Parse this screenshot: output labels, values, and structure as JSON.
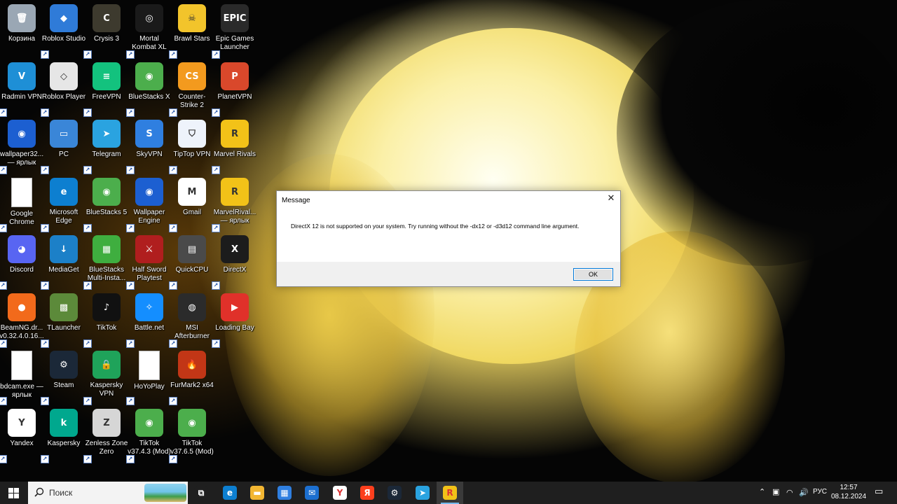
{
  "desktop": {
    "icons": [
      {
        "label": "Корзина",
        "icon": "recycle-bin-icon",
        "color": "#9aa7b4",
        "glyph": "🗑"
      },
      {
        "label": "Roblox Studio",
        "icon": "roblox-studio-icon",
        "color": "#2f7bd8",
        "glyph": "◆"
      },
      {
        "label": "Crysis 3",
        "icon": "crysis-icon",
        "color": "#3d3a2e",
        "glyph": "C"
      },
      {
        "label": "Mortal Kombat XL",
        "icon": "mortal-kombat-icon",
        "color": "#1a1a1a",
        "glyph": "◎"
      },
      {
        "label": "Brawl Stars",
        "icon": "brawl-stars-icon",
        "color": "#f2c42b",
        "glyph": "☠"
      },
      {
        "label": "Epic Games Launcher",
        "icon": "epic-games-icon",
        "color": "#2a2a2a",
        "glyph": "EPIC"
      },
      {
        "label": "Radmin VPN",
        "icon": "radmin-vpn-icon",
        "color": "#1e8fd6",
        "glyph": "V"
      },
      {
        "label": "Roblox Player",
        "icon": "roblox-player-icon",
        "color": "#e6e6e6",
        "glyph": "◇"
      },
      {
        "label": "FreeVPN",
        "icon": "freevpn-icon",
        "color": "#13c27e",
        "glyph": "≡"
      },
      {
        "label": "BlueStacks X",
        "icon": "bluestacks-x-icon",
        "color": "#4cae4c",
        "glyph": "◉"
      },
      {
        "label": "Counter-Strike 2",
        "icon": "counter-strike-icon",
        "color": "#f39a1e",
        "glyph": "CS"
      },
      {
        "label": "PlanetVPN",
        "icon": "planetvpn-icon",
        "color": "#d9482b",
        "glyph": "P"
      },
      {
        "label": "wallpaper32... — ярлык",
        "icon": "wallpaper-engine-icon",
        "color": "#1c5fd1",
        "glyph": "◉"
      },
      {
        "label": "PC",
        "icon": "computer-icon",
        "color": "#3a86d8",
        "glyph": "▭"
      },
      {
        "label": "Telegram",
        "icon": "telegram-icon",
        "color": "#2aa3e0",
        "glyph": "➤"
      },
      {
        "label": "SkyVPN",
        "icon": "skyvpn-icon",
        "color": "#2f7fe0",
        "glyph": "S"
      },
      {
        "label": "TipTop VPN",
        "icon": "tiptop-vpn-icon",
        "color": "#eef3fb",
        "glyph": "⛉"
      },
      {
        "label": "Marvel Rivals",
        "icon": "marvel-rivals-icon",
        "color": "#f2c218",
        "glyph": "R"
      },
      {
        "label": "Google Chrome",
        "icon": "file-icon",
        "color": "#ffffff",
        "glyph": ""
      },
      {
        "label": "Microsoft Edge",
        "icon": "edge-icon",
        "color": "#0d7fd0",
        "glyph": "e"
      },
      {
        "label": "BlueStacks 5",
        "icon": "bluestacks-5-icon",
        "color": "#4cae4c",
        "glyph": "◉"
      },
      {
        "label": "Wallpaper Engine",
        "icon": "wallpaper-engine-icon",
        "color": "#1c5fd1",
        "glyph": "◉"
      },
      {
        "label": "Gmail",
        "icon": "gmail-icon",
        "color": "#ffffff",
        "glyph": "M"
      },
      {
        "label": "MarvelRival... — ярлык",
        "icon": "marvel-rivals-icon",
        "color": "#f2c218",
        "glyph": "R"
      },
      {
        "label": "Discord",
        "icon": "discord-icon",
        "color": "#5865f2",
        "glyph": "◕"
      },
      {
        "label": "MediaGet",
        "icon": "mediaget-icon",
        "color": "#1c80c8",
        "glyph": "↓"
      },
      {
        "label": "BlueStacks Multi-Insta...",
        "icon": "bluestacks-multi-icon",
        "color": "#3fae3f",
        "glyph": "▦"
      },
      {
        "label": "Half Sword Playtest",
        "icon": "half-sword-icon",
        "color": "#b01e1e",
        "glyph": "⚔"
      },
      {
        "label": "QuickCPU",
        "icon": "quickcpu-icon",
        "color": "#4a4a4a",
        "glyph": "▤"
      },
      {
        "label": "DirectX",
        "icon": "directx-icon",
        "color": "#1c1c1c",
        "glyph": "X"
      },
      {
        "label": "BeamNG.dr... v0.32.4.0.16...",
        "icon": "beamng-icon",
        "color": "#f26a1b",
        "glyph": "●"
      },
      {
        "label": "TLauncher",
        "icon": "tlauncher-icon",
        "color": "#5c8a3a",
        "glyph": "▩"
      },
      {
        "label": "TikTok",
        "icon": "tiktok-icon",
        "color": "#111111",
        "glyph": "♪"
      },
      {
        "label": "Battle.net",
        "icon": "battlenet-icon",
        "color": "#148eff",
        "glyph": "✧"
      },
      {
        "label": "MSI Afterburner",
        "icon": "msi-afterburner-icon",
        "color": "#2b2b2b",
        "glyph": "◍"
      },
      {
        "label": "Loading Bay",
        "icon": "loading-bay-icon",
        "color": "#e0312a",
        "glyph": "▶"
      },
      {
        "label": "bdcam.exe — ярлык",
        "icon": "file-icon",
        "color": "#ffffff",
        "glyph": ""
      },
      {
        "label": "Steam",
        "icon": "steam-icon",
        "color": "#1b2838",
        "glyph": "⚙"
      },
      {
        "label": "Kaspersky VPN",
        "icon": "kaspersky-vpn-icon",
        "color": "#1fa35a",
        "glyph": "🔒"
      },
      {
        "label": "HoYoPlay",
        "icon": "file-icon",
        "color": "#ffffff",
        "glyph": ""
      },
      {
        "label": "FurMark2 x64",
        "icon": "furmark-icon",
        "color": "#c23616",
        "glyph": "🔥"
      },
      {
        "label": "",
        "icon": "",
        "color": "",
        "glyph": ""
      },
      {
        "label": "Yandex",
        "icon": "yandex-browser-icon",
        "color": "#ffffff",
        "glyph": "Y"
      },
      {
        "label": "Kaspersky",
        "icon": "kaspersky-icon",
        "color": "#00a88e",
        "glyph": "k"
      },
      {
        "label": "Zenless Zone Zero",
        "icon": "zenless-zone-zero-icon",
        "color": "#d6d6d6",
        "glyph": "Z"
      },
      {
        "label": "TikTok v37.4.3 (Mod) arm8...",
        "icon": "bluestacks-app-icon",
        "color": "#4cae4c",
        "glyph": "◉"
      },
      {
        "label": "TikTok v37.6.5 (Mod) arm8...",
        "icon": "bluestacks-app-icon",
        "color": "#4cae4c",
        "glyph": "◉"
      },
      {
        "label": "",
        "icon": "",
        "color": "",
        "glyph": ""
      }
    ]
  },
  "dialog": {
    "title": "Message",
    "message": "DirectX 12 is not supported on your system. Try running without the -dx12 or -d3d12 command line argument.",
    "ok_label": "OK"
  },
  "taskbar": {
    "search_placeholder": "Поиск",
    "apps": [
      {
        "icon": "task-view-icon",
        "color": "#1f1f1f",
        "glyph": "⧉"
      },
      {
        "icon": "edge-icon",
        "color": "#0d7fd0",
        "glyph": "e"
      },
      {
        "icon": "file-explorer-icon",
        "color": "#f2b632",
        "glyph": "▬"
      },
      {
        "icon": "microsoft-store-icon",
        "color": "#2f7fe0",
        "glyph": "▦"
      },
      {
        "icon": "mail-icon",
        "color": "#1c6fd0",
        "glyph": "✉"
      },
      {
        "icon": "yandex-browser-icon",
        "color": "#ffffff",
        "glyph": "Y"
      },
      {
        "icon": "yandex-icon",
        "color": "#fc3f1d",
        "glyph": "Я"
      },
      {
        "icon": "steam-icon",
        "color": "#1b2838",
        "glyph": "⚙"
      },
      {
        "icon": "telegram-icon",
        "color": "#2aa3e0",
        "glyph": "➤"
      },
      {
        "icon": "marvel-rivals-icon",
        "color": "#f2c218",
        "glyph": "R"
      }
    ],
    "language": "РУС",
    "time": "12:57",
    "date": "08.12.2024"
  },
  "colors": {
    "taskbar_bg": "#1f1f1f",
    "accent": "#0078d7"
  }
}
